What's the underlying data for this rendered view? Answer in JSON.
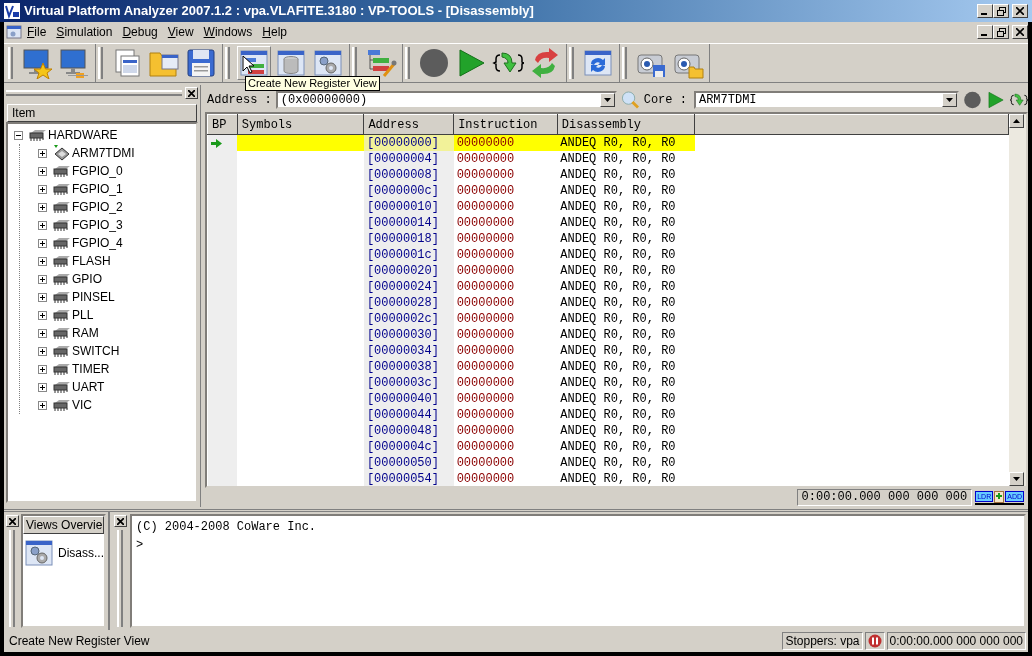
{
  "window": {
    "title": "Virtual Platform Analyzer 2007.1.2 : vpa.VLAFITE.3180 : VP-TOOLS - [Disassembly]"
  },
  "menu": [
    "File",
    "Simulation",
    "Debug",
    "View",
    "Windows",
    "Help"
  ],
  "tooltip": {
    "text": "Create New Register View"
  },
  "tree": {
    "header": "Item",
    "items": [
      {
        "label": "HARDWARE",
        "kind": "board",
        "expanded": true,
        "children": [
          {
            "label": "ARM7TDMI",
            "kind": "core",
            "expanded": false
          },
          {
            "label": "FGPIO_0",
            "kind": "chip",
            "expanded": false
          },
          {
            "label": "FGPIO_1",
            "kind": "chip",
            "expanded": false
          },
          {
            "label": "FGPIO_2",
            "kind": "chip",
            "expanded": false
          },
          {
            "label": "FGPIO_3",
            "kind": "chip",
            "expanded": false
          },
          {
            "label": "FGPIO_4",
            "kind": "chip",
            "expanded": false
          },
          {
            "label": "FLASH",
            "kind": "chip",
            "expanded": false
          },
          {
            "label": "GPIO",
            "kind": "chip",
            "expanded": false
          },
          {
            "label": "PINSEL",
            "kind": "chip",
            "expanded": false
          },
          {
            "label": "PLL",
            "kind": "chip",
            "expanded": false
          },
          {
            "label": "RAM",
            "kind": "chip",
            "expanded": false
          },
          {
            "label": "SWITCH",
            "kind": "chip",
            "expanded": false
          },
          {
            "label": "TIMER",
            "kind": "chip",
            "expanded": false
          },
          {
            "label": "UART",
            "kind": "chip",
            "expanded": false
          },
          {
            "label": "VIC",
            "kind": "chip",
            "expanded": false
          }
        ]
      }
    ]
  },
  "address_bar": {
    "address_label": "Address :",
    "address_value": "(0x00000000)",
    "core_label": "Core :",
    "core_value": "ARM7TDMI"
  },
  "disassembly": {
    "columns": [
      "BP",
      "Symbols",
      "Address",
      "Instruction",
      "Disassembly"
    ],
    "rows": [
      {
        "address": "[00000000]",
        "instruction": "00000000",
        "disassembly": "ANDEQ R0, R0, R0",
        "current": true
      },
      {
        "address": "[00000004]",
        "instruction": "00000000",
        "disassembly": "ANDEQ R0, R0, R0",
        "current": false
      },
      {
        "address": "[00000008]",
        "instruction": "00000000",
        "disassembly": "ANDEQ R0, R0, R0",
        "current": false
      },
      {
        "address": "[0000000c]",
        "instruction": "00000000",
        "disassembly": "ANDEQ R0, R0, R0",
        "current": false
      },
      {
        "address": "[00000010]",
        "instruction": "00000000",
        "disassembly": "ANDEQ R0, R0, R0",
        "current": false
      },
      {
        "address": "[00000014]",
        "instruction": "00000000",
        "disassembly": "ANDEQ R0, R0, R0",
        "current": false
      },
      {
        "address": "[00000018]",
        "instruction": "00000000",
        "disassembly": "ANDEQ R0, R0, R0",
        "current": false
      },
      {
        "address": "[0000001c]",
        "instruction": "00000000",
        "disassembly": "ANDEQ R0, R0, R0",
        "current": false
      },
      {
        "address": "[00000020]",
        "instruction": "00000000",
        "disassembly": "ANDEQ R0, R0, R0",
        "current": false
      },
      {
        "address": "[00000024]",
        "instruction": "00000000",
        "disassembly": "ANDEQ R0, R0, R0",
        "current": false
      },
      {
        "address": "[00000028]",
        "instruction": "00000000",
        "disassembly": "ANDEQ R0, R0, R0",
        "current": false
      },
      {
        "address": "[0000002c]",
        "instruction": "00000000",
        "disassembly": "ANDEQ R0, R0, R0",
        "current": false
      },
      {
        "address": "[00000030]",
        "instruction": "00000000",
        "disassembly": "ANDEQ R0, R0, R0",
        "current": false
      },
      {
        "address": "[00000034]",
        "instruction": "00000000",
        "disassembly": "ANDEQ R0, R0, R0",
        "current": false
      },
      {
        "address": "[00000038]",
        "instruction": "00000000",
        "disassembly": "ANDEQ R0, R0, R0",
        "current": false
      },
      {
        "address": "[0000003c]",
        "instruction": "00000000",
        "disassembly": "ANDEQ R0, R0, R0",
        "current": false
      },
      {
        "address": "[00000040]",
        "instruction": "00000000",
        "disassembly": "ANDEQ R0, R0, R0",
        "current": false
      },
      {
        "address": "[00000044]",
        "instruction": "00000000",
        "disassembly": "ANDEQ R0, R0, R0",
        "current": false
      },
      {
        "address": "[00000048]",
        "instruction": "00000000",
        "disassembly": "ANDEQ R0, R0, R0",
        "current": false
      },
      {
        "address": "[0000004c]",
        "instruction": "00000000",
        "disassembly": "ANDEQ R0, R0, R0",
        "current": false
      },
      {
        "address": "[00000050]",
        "instruction": "00000000",
        "disassembly": "ANDEQ R0, R0, R0",
        "current": false
      },
      {
        "address": "[00000054]",
        "instruction": "00000000",
        "disassembly": "ANDEQ R0, R0, R0",
        "current": false
      }
    ]
  },
  "timer": "0:00:00.000 000 000 000",
  "pipeline": [
    "LDR",
    "ADD"
  ],
  "views_overview": {
    "tab": "Views Overvie",
    "items": [
      {
        "label": "Disass..."
      }
    ]
  },
  "console": {
    "lines": [
      "(C) 2004-2008 CoWare Inc.",
      ">"
    ]
  },
  "status_bar": {
    "message": "Create New Register View",
    "stoppers": "Stoppers: vpa",
    "time": "0:00:00.000 000 000 000"
  }
}
